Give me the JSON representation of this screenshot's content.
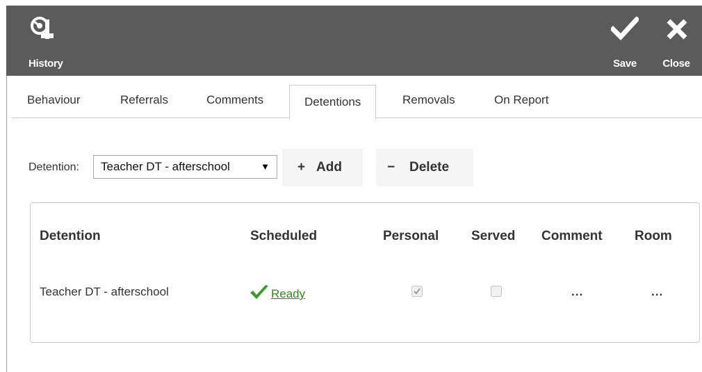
{
  "header": {
    "history_label": "History",
    "save_label": "Save",
    "close_label": "Close",
    "background_color": "#5b5b5b"
  },
  "tabs": [
    {
      "label": "Behaviour",
      "active": false
    },
    {
      "label": "Referrals",
      "active": false
    },
    {
      "label": "Comments",
      "active": false
    },
    {
      "label": "Detentions",
      "active": true
    },
    {
      "label": "Removals",
      "active": false
    },
    {
      "label": "On Report",
      "active": false
    }
  ],
  "toolbar": {
    "detention_label": "Detention:",
    "detention_selected": "Teacher DT - afterschool",
    "select_arrow": "▼",
    "add_icon": "+",
    "add_label": "Add",
    "delete_icon": "−",
    "delete_label": "Delete"
  },
  "table": {
    "columns": [
      "Detention",
      "Scheduled",
      "Personal",
      "Served",
      "Comment",
      "Room"
    ],
    "rows": [
      {
        "detention": "Teacher DT - afterschool",
        "scheduled": "Ready",
        "personal_checked": true,
        "served_checked": false,
        "comment": "...",
        "room": "..."
      }
    ]
  },
  "colors": {
    "ready_green": "#2e8b1f",
    "check_green": "#3a9a2a"
  },
  "icons": {
    "history": "history-icon",
    "save": "checkmark-icon",
    "close": "close-x-icon",
    "ready": "green-check-icon"
  }
}
